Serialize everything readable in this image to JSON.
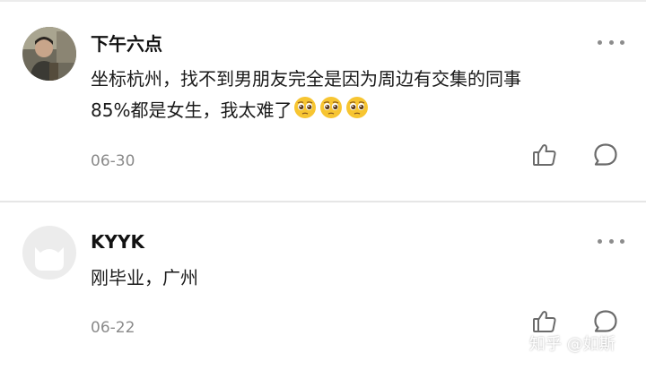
{
  "comments": [
    {
      "author": "下午六点",
      "text_line1": "坐标杭州，找不到男朋友完全是因为周边有交集的同事",
      "text_line2": "85%都是女生，我太难了",
      "date": "06-30",
      "emoji": "pleading-face-emoji"
    },
    {
      "author": "KYYK",
      "text_line1": "刚毕业，广州",
      "date": "06-22"
    }
  ],
  "watermark": "知乎 @如斯",
  "icons": [
    "more-icon",
    "like-icon",
    "reply-icon"
  ],
  "colors": {
    "text": "#1a1a1a",
    "secondary": "#8a8a8a",
    "divider": "#e6e6e6",
    "emoji": "#f7c531"
  }
}
